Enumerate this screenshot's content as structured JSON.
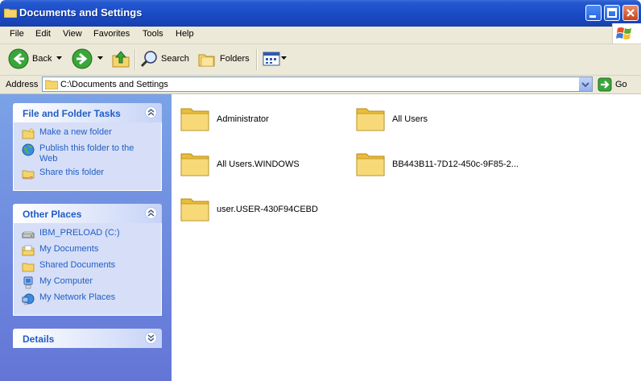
{
  "window": {
    "title": "Documents and Settings"
  },
  "menu": [
    "File",
    "Edit",
    "View",
    "Favorites",
    "Tools",
    "Help"
  ],
  "toolbar": {
    "back_label": "Back",
    "search_label": "Search",
    "folders_label": "Folders"
  },
  "address": {
    "label": "Address",
    "value": "C:\\Documents and Settings",
    "go_label": "Go"
  },
  "tasks_panel": {
    "title": "File and Folder Tasks",
    "items": [
      {
        "label": "Make a new folder",
        "icon": "new-folder-icon"
      },
      {
        "label": "Publish this folder to the Web",
        "icon": "globe-icon"
      },
      {
        "label": "Share this folder",
        "icon": "share-folder-icon"
      }
    ]
  },
  "places_panel": {
    "title": "Other Places",
    "items": [
      {
        "label": "IBM_PRELOAD (C:)",
        "icon": "drive-icon"
      },
      {
        "label": "My Documents",
        "icon": "documents-icon"
      },
      {
        "label": "Shared Documents",
        "icon": "folder-icon"
      },
      {
        "label": "My Computer",
        "icon": "computer-icon"
      },
      {
        "label": "My Network Places",
        "icon": "network-icon"
      }
    ]
  },
  "details_panel": {
    "title": "Details"
  },
  "folders": [
    {
      "name": "Administrator"
    },
    {
      "name": "All Users"
    },
    {
      "name": "All Users.WINDOWS"
    },
    {
      "name": "BB443B11-7D12-450c-9F85-2..."
    },
    {
      "name": "user.USER-430F94CEBD"
    }
  ],
  "colors": {
    "title_bar": "#1a4cc6",
    "sidebar": "#7ba2e7",
    "panel_title": "#215dc6",
    "chrome": "#ece9d8"
  }
}
